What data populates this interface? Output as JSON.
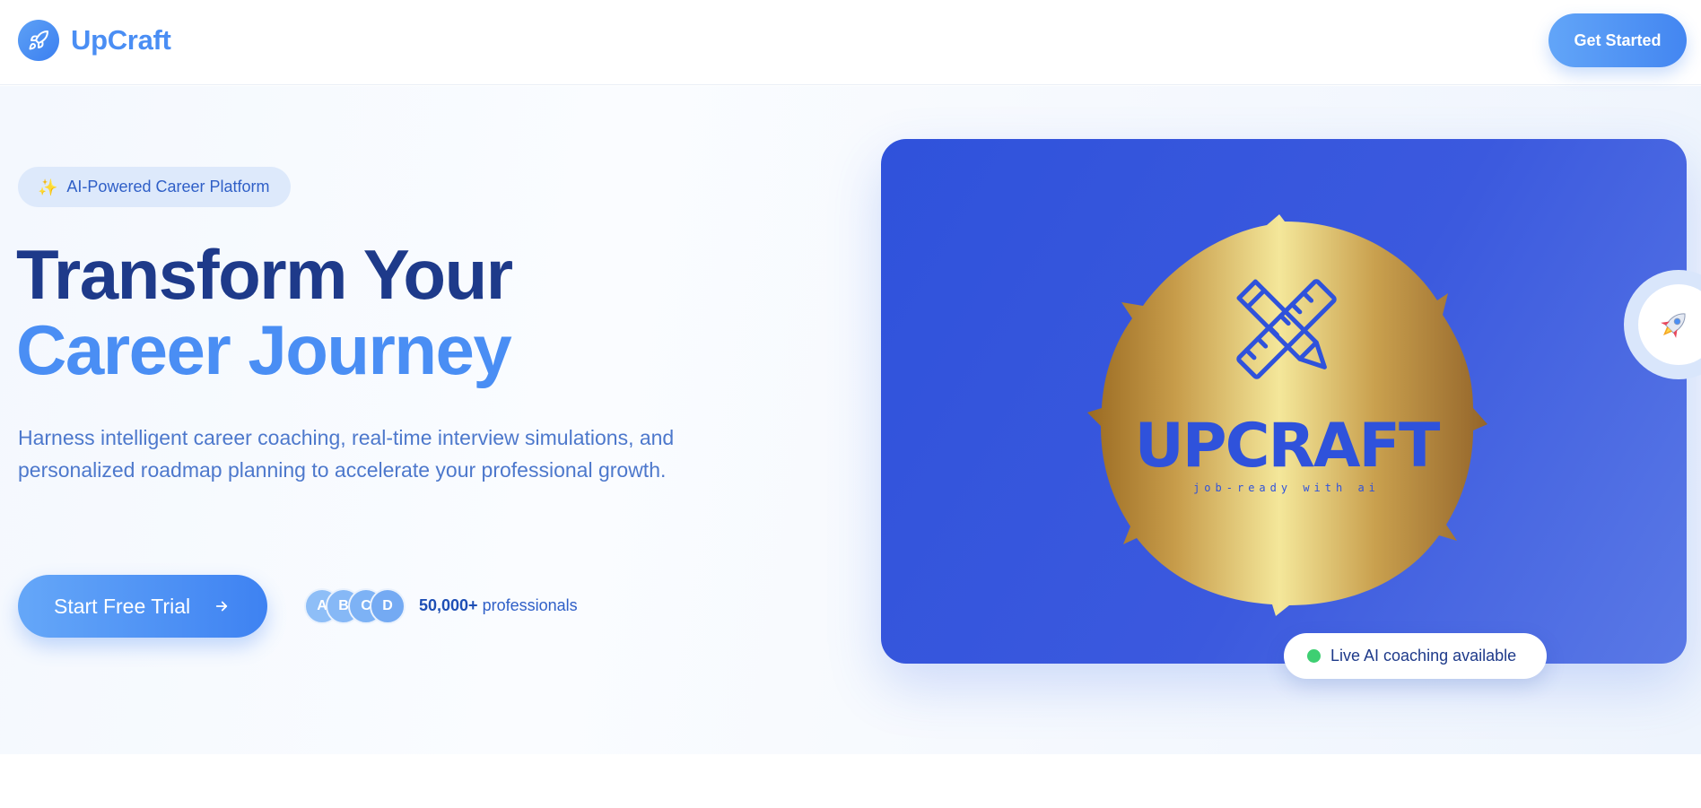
{
  "header": {
    "brand_name": "UpCraft",
    "brand_icon": "rocket-icon",
    "get_started_label": "Get Started"
  },
  "hero": {
    "badge_icon": "✨",
    "badge_text": "AI-Powered Career Platform",
    "headline_line1": "Transform Your",
    "headline_line2": "Career Journey",
    "subtitle": "Harness intelligent career coaching, real-time interview simulations, and personalized roadmap planning to accelerate your professional growth.",
    "cta_label": "Start Free Trial",
    "cta_icon": "arrow-right-icon",
    "avatars": [
      "A",
      "B",
      "C",
      "D"
    ],
    "professionals_count": "50,000+",
    "professionals_label": "professionals"
  },
  "showcase": {
    "logo_title": "UPCRAFT",
    "logo_tagline": "job-ready with ai",
    "live_status": "Live AI coaching available",
    "float_icon": "rocket-icon"
  },
  "colors": {
    "brand": "#4a8ef4",
    "navy": "#1e3a8a",
    "card_blue": "#3b59de",
    "gold": "#d8b35a",
    "live_green": "#3ecf72"
  }
}
